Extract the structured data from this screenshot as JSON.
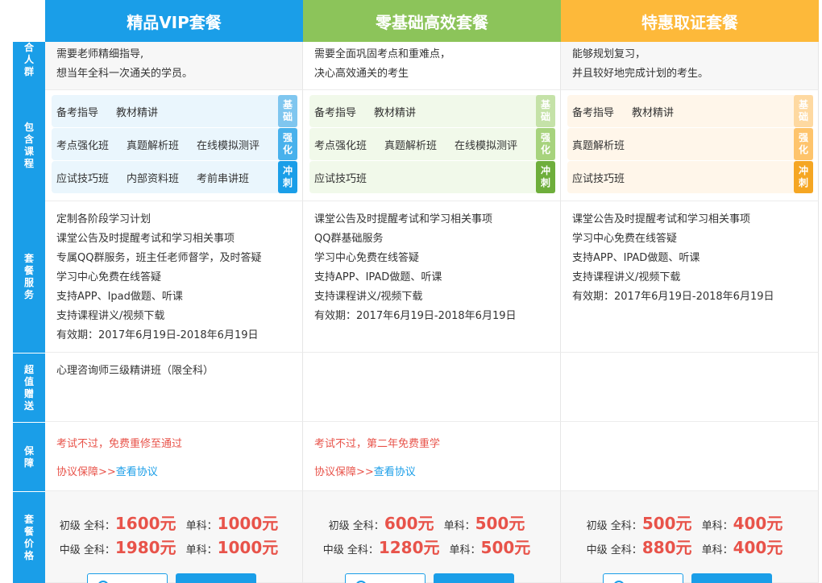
{
  "headers": [
    "精品VIP套餐",
    "零基础高效套餐",
    "特惠取证套餐"
  ],
  "row_labels": {
    "crowd": "适合人群",
    "course": "包含课程",
    "service": "套餐服务",
    "gift": "超值赠送",
    "guarantee": "保障",
    "price": "套餐价格"
  },
  "crowd": [
    [
      "需要老师精细指导,",
      "想当年全科一次通关的学员。"
    ],
    [
      "需要全面巩固考点和重难点，",
      "决心高效通关的考生"
    ],
    [
      "能够规划复习，",
      "并且较好地完成计划的考生。"
    ]
  ],
  "course_tags": [
    "基础",
    "强化",
    "冲刺"
  ],
  "courses": [
    [
      [
        "备考指导",
        "教材精讲"
      ],
      [
        "考点强化班",
        "真题解析班",
        "在线模拟测评"
      ],
      [
        "应试技巧班",
        "内部资料班",
        "考前串讲班"
      ]
    ],
    [
      [
        "备考指导",
        "教材精讲"
      ],
      [
        "考点强化班",
        "真题解析班",
        "在线模拟测评"
      ],
      [
        "应试技巧班"
      ]
    ],
    [
      [
        "备考指导",
        "教材精讲"
      ],
      [
        "真题解析班"
      ],
      [
        "应试技巧班"
      ]
    ]
  ],
  "services": [
    [
      "定制各阶段学习计划",
      "课堂公告及时提醒考试和学习相关事项",
      "专属QQ群服务，班主任老师督学，及时答疑",
      "学习中心免费在线答疑",
      "支持APP、Ipad做题、听课",
      "支持课程讲义/视频下载",
      "有效期：2017年6月19日-2018年6月19日"
    ],
    [
      "课堂公告及时提醒考试和学习相关事项",
      "QQ群基础服务",
      "学习中心免费在线答疑",
      "支持APP、IPAD做题、听课",
      "支持课程讲义/视频下载",
      "有效期：2017年6月19日-2018年6月19日"
    ],
    [
      "课堂公告及时提醒考试和学习相关事项",
      "学习中心免费在线答疑",
      "支持APP、IPAD做题、听课",
      "支持课程讲义/视频下载",
      "有效期：2017年6月19日-2018年6月19日"
    ]
  ],
  "gift": [
    "心理咨询师三级精讲班（限全科）",
    "",
    ""
  ],
  "guarantee": [
    {
      "text": "考试不过，免费重修至通过",
      "link_pre": "协议保障>>",
      "link": "查看协议"
    },
    {
      "text": "考试不过，第二年免费重学",
      "link_pre": "协议保障>>",
      "link": "查看协议"
    },
    {
      "text": "",
      "link_pre": "",
      "link": ""
    }
  ],
  "prices": [
    [
      {
        "level": "初级 全科：",
        "full": "1600元",
        "single_lbl": "单科：",
        "single": "1000元"
      },
      {
        "level": "中级 全科：",
        "full": "1980元",
        "single_lbl": "单科：",
        "single": "1000元"
      }
    ],
    [
      {
        "level": "初级 全科：",
        "full": "600元",
        "single_lbl": "单科：",
        "single": "500元"
      },
      {
        "level": "中级 全科：",
        "full": "1280元",
        "single_lbl": "单科：",
        "single": "500元"
      }
    ],
    [
      {
        "level": "初级 全科：",
        "full": "500元",
        "single_lbl": "单科：",
        "single": "400元"
      },
      {
        "level": "中级 全科：",
        "full": "880元",
        "single_lbl": "单科：",
        "single": "400元"
      }
    ]
  ],
  "colors": {
    "blue": "#1a9ee8",
    "green": "#8cc45a",
    "orange": "#fdb93a",
    "red": "#e8534a"
  }
}
